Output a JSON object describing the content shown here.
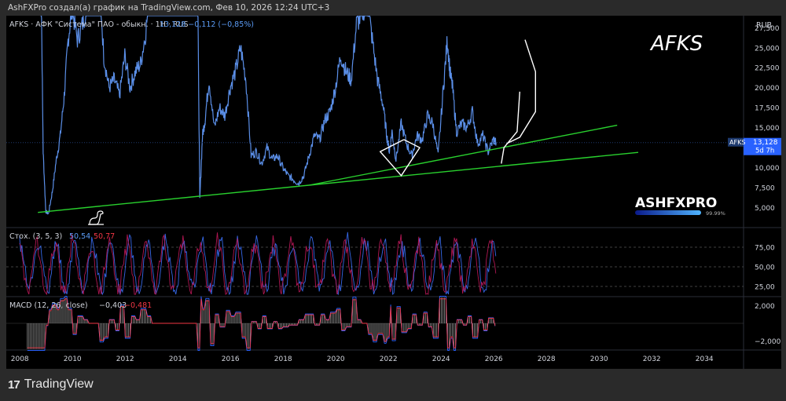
{
  "header_text": "AshFXPro создал(а) график на TradingView.com, Фев 10, 2026 12:24 UTC+3",
  "brand": {
    "name": "TradingView",
    "logo_text": "17"
  },
  "watermark": {
    "ticker": "AFKS",
    "author": "ASHFXPRO",
    "percent": "99.99%"
  },
  "chart_data": [
    {
      "type": "line",
      "title": "AFKS · АФК \"Система\" ПАО - обыкн. · 1H · RUS",
      "legend_values": "13,128  −0,112 (−0,85%)",
      "currency": "RUB",
      "last_price": {
        "ticker": "AFKS",
        "value": "13,128",
        "timer": "5d 7h"
      },
      "ylim": [
        2500,
        29000
      ],
      "y_ticks": [
        "5,000",
        "7,500",
        "10,000",
        "12,500",
        "15,000",
        "17,500",
        "20,000",
        "22,500",
        "25,000",
        "27,500"
      ],
      "x_ticks": [
        "2008",
        "2010",
        "2012",
        "2014",
        "2016",
        "2018",
        "2020",
        "2022",
        "2024",
        "2026",
        "2028",
        "2030",
        "2032",
        "2034"
      ],
      "xlim": [
        2007.5,
        2035.5
      ],
      "series": [
        {
          "x": [
            2008.8,
            2008.9,
            2009.0,
            2009.1,
            2009.25,
            2009.4,
            2009.55,
            2009.7,
            2009.85,
            2010.0,
            2010.2,
            2010.4,
            2010.6,
            2010.8,
            2011.0,
            2011.2,
            2011.4,
            2011.6,
            2011.8,
            2012.0,
            2012.2,
            2012.4,
            2012.6,
            2012.8,
            2013.0,
            2013.2,
            2013.4,
            2013.6,
            2013.8,
            2014.0,
            2014.2,
            2014.4,
            2014.6,
            2014.75,
            2014.85,
            2014.95,
            2015.05,
            2015.2,
            2015.4,
            2015.6,
            2015.8,
            2016.0,
            2016.2,
            2016.4,
            2016.6,
            2016.8,
            2017.0,
            2017.2,
            2017.4,
            2017.6,
            2017.8,
            2018.0,
            2018.2,
            2018.4,
            2018.6,
            2018.8,
            2019.0,
            2019.2,
            2019.4,
            2019.6,
            2019.8,
            2020.0,
            2020.2,
            2020.4,
            2020.6,
            2020.8,
            2021.0,
            2021.2,
            2021.4,
            2021.6,
            2021.8,
            2021.95,
            2022.05,
            2022.15,
            2022.3,
            2022.5,
            2022.7,
            2022.9,
            2023.1,
            2023.3,
            2023.5,
            2023.7,
            2023.9,
            2024.1,
            2024.25,
            2024.35,
            2024.45,
            2024.6,
            2024.8,
            2025.0,
            2025.2,
            2025.4,
            2025.6,
            2025.8,
            2026.0,
            2026.1
          ],
          "y": [
            40000,
            12000,
            4500,
            4200,
            7000,
            11000,
            14000,
            19000,
            26000,
            30000,
            26000,
            28000,
            31000,
            40000,
            36000,
            24000,
            20000,
            21000,
            19000,
            24000,
            20000,
            22000,
            23000,
            27000,
            34000,
            38000,
            37000,
            40000,
            40000,
            40000,
            40000,
            40000,
            40000,
            38000,
            6000,
            14000,
            16000,
            21000,
            15000,
            17500,
            16500,
            20000,
            22000,
            25000,
            21000,
            11500,
            12000,
            10500,
            12500,
            11000,
            11500,
            10000,
            9000,
            8500,
            8000,
            9000,
            11500,
            14000,
            13500,
            16000,
            17000,
            20000,
            24000,
            22000,
            21000,
            28000,
            29000,
            31000,
            26000,
            21000,
            18000,
            14000,
            12000,
            14500,
            11000,
            15500,
            13000,
            11500,
            14000,
            13500,
            16500,
            15500,
            11500,
            20000,
            26000,
            22000,
            20000,
            14500,
            15500,
            15000,
            17000,
            13000,
            14000,
            12000,
            13500,
            13128
          ],
          "name": "AFKS"
        }
      ],
      "annotations": {
        "trendlines": [
          {
            "from": [
              2008.7,
              4400
            ],
            "to": [
              2019.0,
              7800
            ],
            "color": "#29d12e"
          },
          {
            "from": [
              2019.0,
              7800
            ],
            "to": [
              2031.5,
              11900
            ],
            "color": "#29d12e"
          },
          {
            "from": [
              2019.0,
              7800
            ],
            "to": [
              2030.7,
              15300
            ],
            "color": "#29d12e"
          }
        ],
        "arrows": [
          {
            "points": [
              [
                2022.6,
                13500
              ],
              [
                2021.7,
                12000
              ],
              [
                2022.5,
                9000
              ],
              [
                2023.2,
                12500
              ],
              [
                2022.6,
                13500
              ]
            ],
            "color": "#ffffff"
          },
          {
            "points": [
              [
                2026.3,
                10500
              ],
              [
                2026.4,
                12500
              ],
              [
                2026.9,
                14500
              ],
              [
                2027.0,
                19500
              ]
            ],
            "color": "#ffffff"
          },
          {
            "points": [
              [
                2026.5,
                13000
              ],
              [
                2027.0,
                13800
              ],
              [
                2027.6,
                17000
              ],
              [
                2027.6,
                22000
              ],
              [
                2027.2,
                26000
              ]
            ],
            "color": "#ffffff"
          }
        ]
      }
    },
    {
      "type": "line",
      "title": "Стох. (3, 5, 3)",
      "values_text": [
        "50,54",
        "50,77"
      ],
      "ylim": [
        12,
        100
      ],
      "y_ticks": [
        "25,00",
        "50,00",
        "75,00"
      ],
      "series": [
        {
          "colors": [
            "#3b72ff",
            "#c2185b"
          ],
          "x_start": 2008.0,
          "x_end": 2026.1
        }
      ]
    },
    {
      "type": "bar",
      "title": "MACD (12, 26, close)",
      "values_text": [
        "−0,403",
        "−0,481"
      ],
      "ylim": [
        -3000,
        3000
      ],
      "y_ticks": [
        "2,000",
        "−2,000"
      ],
      "series": [
        {
          "name": "Histogram",
          "x_start": 2008.3,
          "x_end": 2026.1
        }
      ]
    }
  ]
}
